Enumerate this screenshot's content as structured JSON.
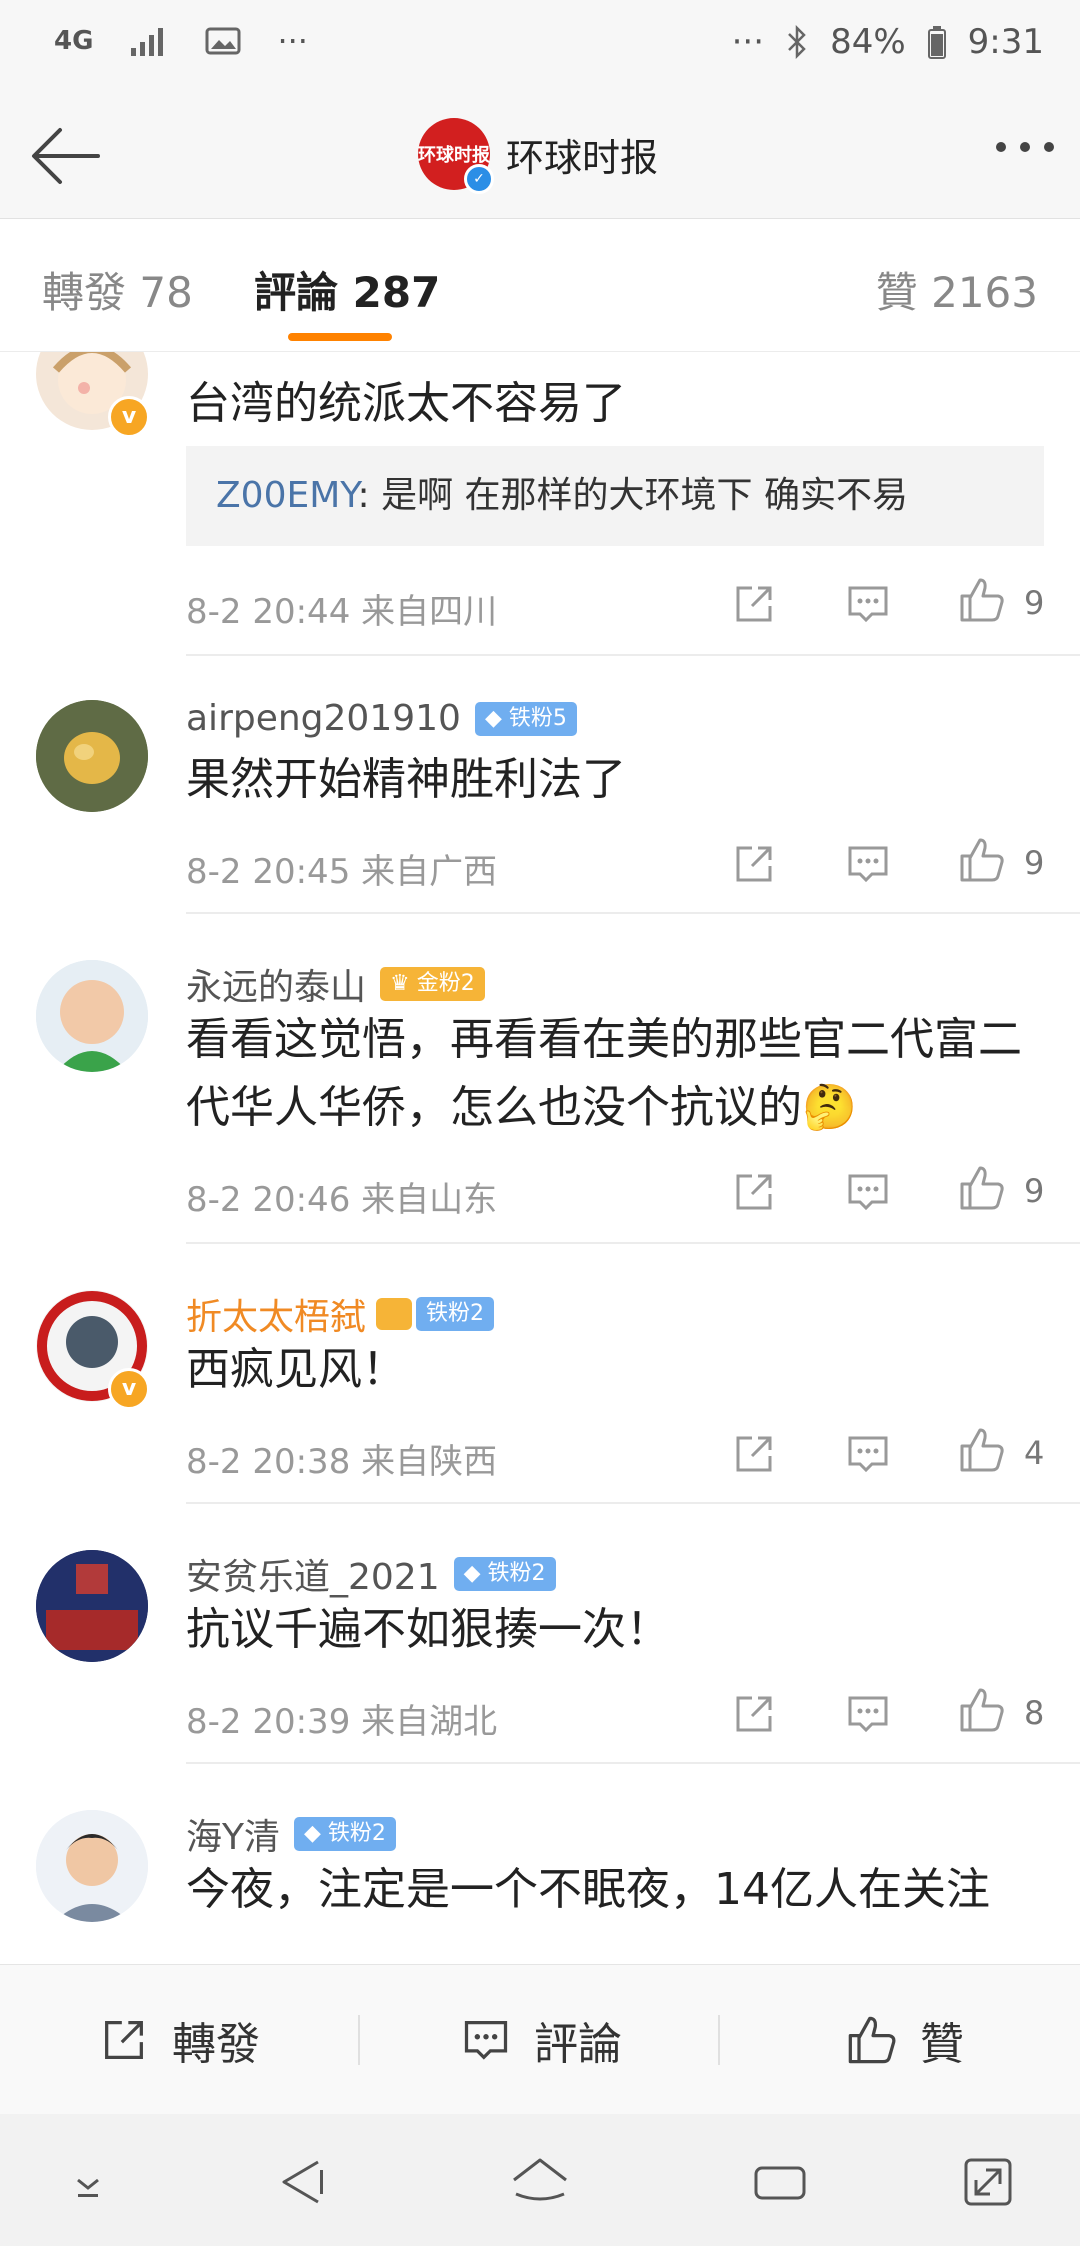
{
  "status_bar": {
    "network": "4G",
    "battery": "84%",
    "time": "9:31"
  },
  "header": {
    "title": "环球时报",
    "logo_text": "环球时报"
  },
  "tabs": [
    {
      "label": "轉發 78"
    },
    {
      "label": "評論 287"
    },
    {
      "label": "贊 2163"
    }
  ],
  "comments": [
    {
      "username": "",
      "text": "台湾的统派太不容易了",
      "reply": {
        "user": "Z00EMY",
        "text": ": 是啊 在那样的大环境下 确实不易"
      },
      "meta": "8-2 20:44  来自四川",
      "likes": "9"
    },
    {
      "username": "airpeng201910",
      "badge": "铁粉5",
      "text": "果然开始精神胜利法了",
      "meta": "8-2 20:45  来自广西",
      "likes": "9"
    },
    {
      "username": "永远的泰山",
      "badge": "金粉2",
      "text": "看看这觉悟，再看看在美的那些官二代富二代华人华侨，怎么也没个抗议的",
      "meta": "8-2 20:46  来自山东",
      "likes": "9"
    },
    {
      "username": "折太太梧弑",
      "badge": "铁粉2",
      "text": "西疯见风！",
      "meta": "8-2 20:38  来自陕西",
      "likes": "4"
    },
    {
      "username": "安贫乐道_2021",
      "badge": "铁粉2",
      "text": "抗议千遍不如狠揍一次！",
      "meta": "8-2 20:39  来自湖北",
      "likes": "8"
    },
    {
      "username": "海Y清",
      "badge": "铁粉2",
      "text": "今夜，注定是一个不眠夜，14亿人在关注"
    }
  ],
  "action_bar": {
    "repost": "轉發",
    "comment": "評論",
    "like": "贊"
  },
  "colors": {
    "accent": "#ff8200",
    "link": "#4a74a8",
    "vip_name": "#f08a24",
    "brand_red": "#d21f1f"
  }
}
